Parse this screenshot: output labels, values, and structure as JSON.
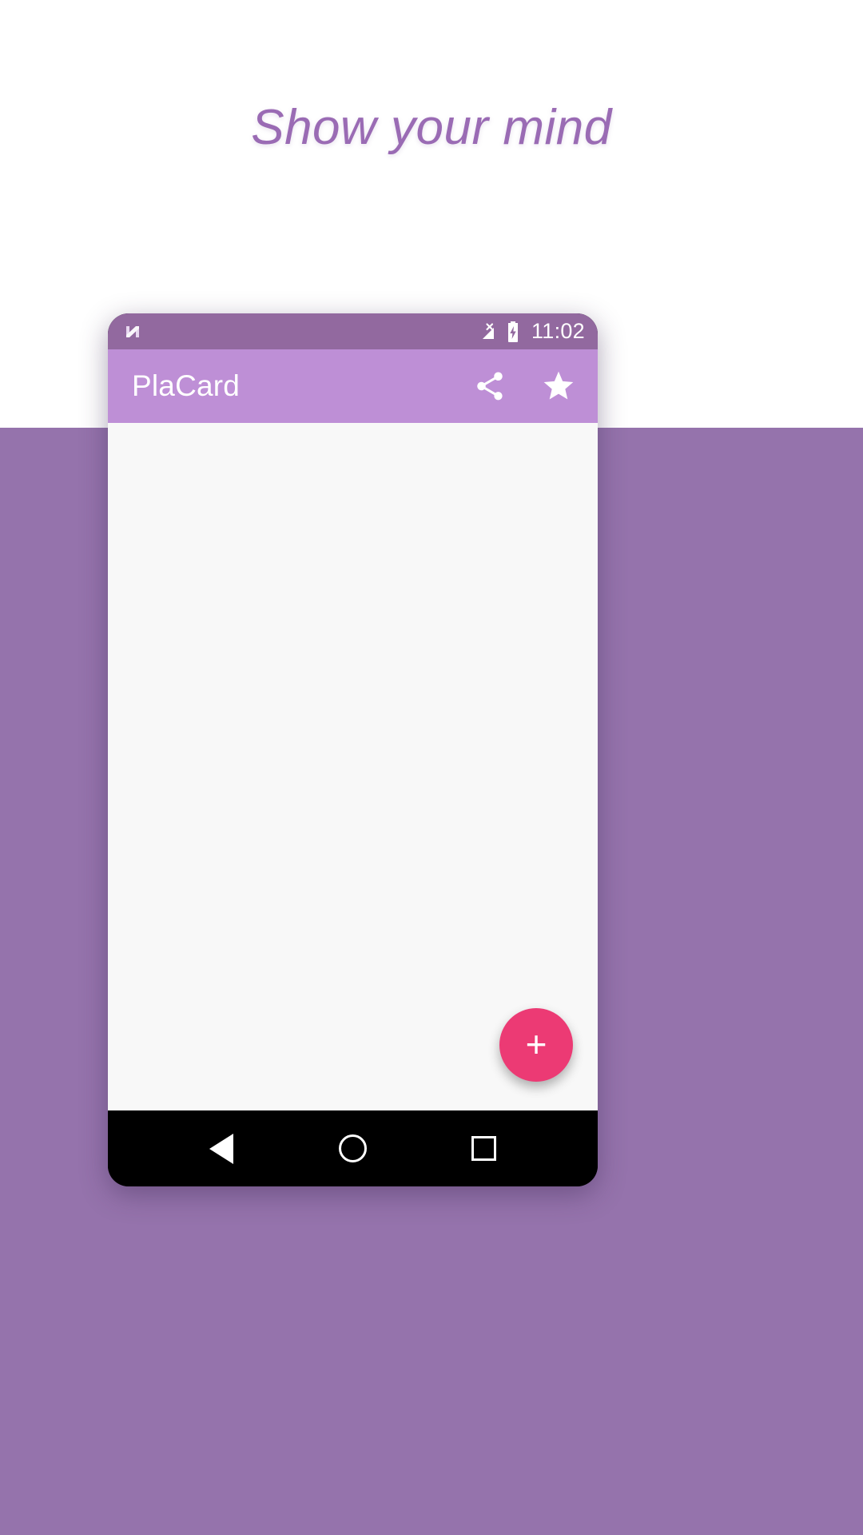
{
  "promo": {
    "headline": "Show your mind",
    "headline_color": "#9a6bb4",
    "background_color": "#9573ac"
  },
  "device": {
    "statusbar": {
      "os_logo": "android-nougat-n-icon",
      "signal_icon": "signal-no-sim-icon",
      "battery_icon": "battery-charging-icon",
      "time": "11:02",
      "background_color": "#92699f"
    },
    "appbar": {
      "title": "PlaCard",
      "background_color": "#be8fd6",
      "actions": [
        {
          "name": "share-icon",
          "label": "Share"
        },
        {
          "name": "star-icon",
          "label": "Favorites"
        }
      ]
    },
    "content": {
      "background_color": "#f8f8f8",
      "fab": {
        "label": "+",
        "color": "#ec3a74",
        "name": "add-card-fab"
      }
    },
    "navbar": {
      "background_color": "#000000",
      "buttons": [
        {
          "name": "nav-back-button",
          "label": "Back"
        },
        {
          "name": "nav-home-button",
          "label": "Home"
        },
        {
          "name": "nav-recents-button",
          "label": "Recents"
        }
      ]
    }
  }
}
